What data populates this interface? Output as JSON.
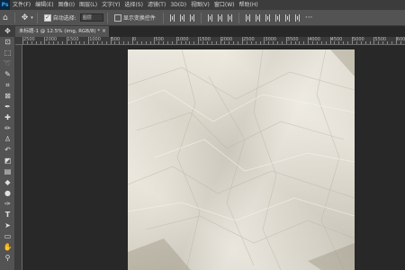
{
  "app": {
    "logo": "Ps"
  },
  "menu": [
    "文件(F)",
    "编辑(E)",
    "图像(I)",
    "图层(L)",
    "文字(Y)",
    "选择(S)",
    "滤镜(T)",
    "3D(D)",
    "视图(V)",
    "窗口(W)",
    "帮助(H)"
  ],
  "options": {
    "auto_select_label": "自动选择:",
    "auto_select_value": "图层",
    "show_transform_label": "显示变换控件"
  },
  "document": {
    "tab_title": "未标题-1 @ 12.5% (img, RGB/8) *",
    "close": "×"
  },
  "ruler": {
    "labels": [
      "2500",
      "2000",
      "1500",
      "1000",
      "500",
      "0",
      "500",
      "1000",
      "1500",
      "2000",
      "2500",
      "3000",
      "3500",
      "4000",
      "4500",
      "5000",
      "5500",
      "600"
    ]
  },
  "tools": [
    "move",
    "artboard",
    "marquee",
    "lasso",
    "magic-wand",
    "crop",
    "frame",
    "eyedropper",
    "healing",
    "brush",
    "clone-stamp",
    "history-brush",
    "eraser",
    "gradient",
    "blur",
    "dodge",
    "pen",
    "type",
    "path-select",
    "rectangle",
    "hand",
    "zoom"
  ],
  "colors": {
    "paper": "#e9e4d6",
    "workspace": "#282828",
    "panel": "#535353"
  }
}
